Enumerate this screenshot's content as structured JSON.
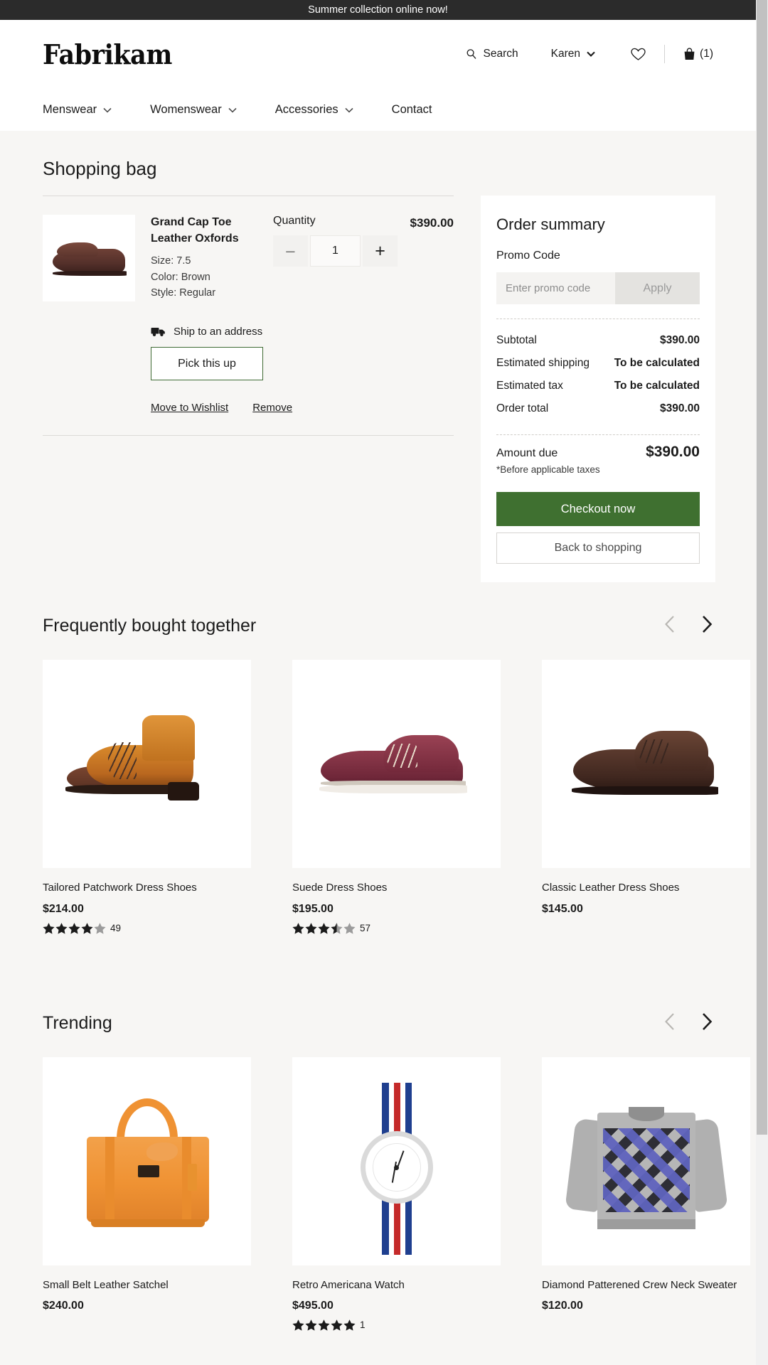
{
  "announcement": {
    "text": "Summer collection online now!"
  },
  "header": {
    "logo": "Fabrikam",
    "search_label": "Search",
    "user_label": "Karen",
    "bag_count": "(1)",
    "nav": [
      {
        "label": "Menswear",
        "has_caret": true
      },
      {
        "label": "Womenswear",
        "has_caret": true
      },
      {
        "label": "Accessories",
        "has_caret": true
      },
      {
        "label": "Contact",
        "has_caret": false
      }
    ]
  },
  "bag": {
    "title": "Shopping bag",
    "item": {
      "name": "Grand Cap Toe Leather Oxfords",
      "attrs": [
        {
          "key": "Size:",
          "value": "7.5"
        },
        {
          "key": "Color:",
          "value": "Brown"
        },
        {
          "key": "Style:",
          "value": "Regular"
        }
      ],
      "quantity_label": "Quantity",
      "quantity_value": "1",
      "decrease_label": "–",
      "increase_label": "+",
      "price": "$390.00",
      "shipping_option": "Ship to an address",
      "pickup_button": "Pick this up",
      "move_to_wishlist": "Move to Wishlist",
      "remove": "Remove"
    }
  },
  "summary": {
    "title": "Order summary",
    "promo_label": "Promo Code",
    "promo_placeholder": "Enter promo code",
    "promo_value": "",
    "apply_label": "Apply",
    "rows": [
      {
        "label": "Subtotal",
        "value": "$390.00"
      },
      {
        "label": "Estimated shipping",
        "value": "To be calculated"
      },
      {
        "label": "Estimated tax",
        "value": "To be calculated"
      },
      {
        "label": "Order total",
        "value": "$390.00"
      }
    ],
    "amount_due_label": "Amount due",
    "amount_due_value": "$390.00",
    "tax_note": "*Before applicable taxes",
    "checkout_label": "Checkout now",
    "back_label": "Back to shopping"
  },
  "carousels": [
    {
      "title": "Frequently bought together",
      "products": [
        {
          "name": "Tailored Patchwork Dress Shoes",
          "price": "$214.00",
          "rating": 4,
          "reviews": "49",
          "art": "boot"
        },
        {
          "name": "Suede Dress Shoes",
          "price": "$195.00",
          "rating": 3.5,
          "reviews": "57",
          "art": "suede"
        },
        {
          "name": "Classic Leather Dress Shoes",
          "price": "$145.00",
          "rating": 0,
          "reviews": "",
          "art": "classic"
        }
      ]
    },
    {
      "title": "Trending",
      "products": [
        {
          "name": "Small Belt Leather Satchel",
          "price": "$240.00",
          "rating": 0,
          "reviews": "",
          "art": "satchel"
        },
        {
          "name": "Retro Americana Watch",
          "price": "$495.00",
          "rating": 5,
          "reviews": "1",
          "art": "watch"
        },
        {
          "name": "Diamond Patterened Crew Neck Sweater",
          "price": "$120.00",
          "rating": 0,
          "reviews": "",
          "art": "sweater"
        }
      ]
    }
  ],
  "colors": {
    "accent_green": "#3f7030",
    "dark_bar": "#2b2b2b",
    "page_bg": "#f7f6f4"
  }
}
